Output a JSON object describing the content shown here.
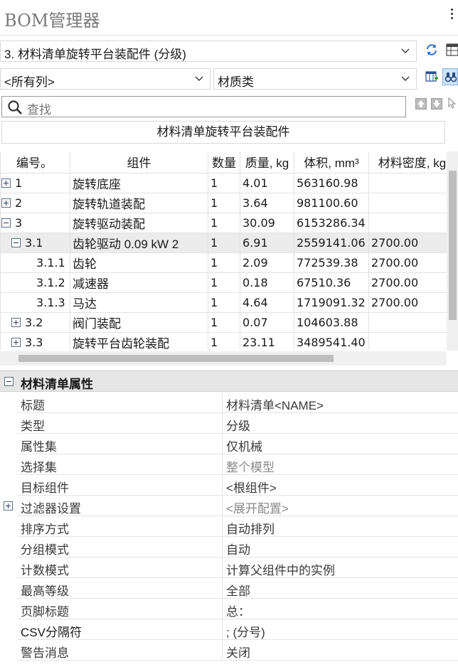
{
  "app": {
    "title": "BOM管理器"
  },
  "toolbar": {
    "bom_select": "3. 材料清单旋转平台装配件 (分级)",
    "columns_select": "<所有列>",
    "category_select": "材质类",
    "search_placeholder": "查找"
  },
  "bom": {
    "title": "材料清单旋转平台装配件",
    "columns": [
      "编号。",
      "组件",
      "数量",
      "质量, kg",
      "体积, mm³",
      "材料密度, kg"
    ],
    "rows": [
      {
        "num": "1",
        "name": "旋转底座",
        "qty": "1",
        "mass": "4.01",
        "volume": "563160.98",
        "density": "",
        "expander": "plus",
        "level": 0
      },
      {
        "num": "2",
        "name": "旋转轨道装配",
        "qty": "1",
        "mass": "3.64",
        "volume": "981100.60",
        "density": "",
        "expander": "plus",
        "level": 0
      },
      {
        "num": "3",
        "name": "旋转驱动装配",
        "qty": "1",
        "mass": "30.09",
        "volume": "6153286.34",
        "density": "",
        "expander": "minus",
        "level": 0
      },
      {
        "num": "3.1",
        "name": "齿轮驱动 0.09 kW 2",
        "qty": "1",
        "mass": "6.91",
        "volume": "2559141.06",
        "density": "2700.00",
        "expander": "minus",
        "level": 1
      },
      {
        "num": "3.1.1",
        "name": "齿轮",
        "qty": "1",
        "mass": "2.09",
        "volume": "772539.38",
        "density": "2700.00",
        "expander": "",
        "level": 2
      },
      {
        "num": "3.1.2",
        "name": "减速器",
        "qty": "1",
        "mass": "0.18",
        "volume": "67510.36",
        "density": "2700.00",
        "expander": "",
        "level": 2
      },
      {
        "num": "3.1.3",
        "name": "马达",
        "qty": "1",
        "mass": "4.64",
        "volume": "1719091.32",
        "density": "2700.00",
        "expander": "",
        "level": 2
      },
      {
        "num": "3.2",
        "name": "阀门装配",
        "qty": "1",
        "mass": "0.07",
        "volume": "104603.88",
        "density": "",
        "expander": "plus",
        "level": 1
      },
      {
        "num": "3.3",
        "name": "旋转平台齿轮装配",
        "qty": "1",
        "mass": "23.11",
        "volume": "3489541.40",
        "density": "",
        "expander": "plus",
        "level": 1
      }
    ]
  },
  "properties": {
    "header": "材料清单属性",
    "items": [
      {
        "key": "标题",
        "value": "材料清单<NAME>",
        "dim": false,
        "expander": false
      },
      {
        "key": "类型",
        "value": "分级",
        "dim": false,
        "expander": false
      },
      {
        "key": "属性集",
        "value": "仅机械",
        "dim": false,
        "expander": false
      },
      {
        "key": "选择集",
        "value": "整个模型",
        "dim": true,
        "expander": false
      },
      {
        "key": "目标组件",
        "value": "<根组件>",
        "dim": false,
        "expander": false
      },
      {
        "key": "过滤器设置",
        "value": "<展开配置>",
        "dim": true,
        "expander": true
      },
      {
        "key": "排序方式",
        "value": "自动排列",
        "dim": false,
        "expander": false
      },
      {
        "key": "分组模式",
        "value": "自动",
        "dim": false,
        "expander": false
      },
      {
        "key": "计数模式",
        "value": "计算父组件中的实例",
        "dim": false,
        "expander": false
      },
      {
        "key": "最高等级",
        "value": "全部",
        "dim": false,
        "expander": false
      },
      {
        "key": "页脚标题",
        "value": "总：",
        "dim": false,
        "expander": false
      },
      {
        "key": "CSV分隔符",
        "value": "; (分号)",
        "dim": false,
        "expander": false
      },
      {
        "key": "警告消息",
        "value": "关闭",
        "dim": false,
        "expander": false
      }
    ]
  },
  "colors": {
    "accent": "#2a6fd6",
    "grid_line": "#e2e2e2",
    "header_bg": "#e6e6e6"
  },
  "icons": [
    "refresh-icon",
    "table-view-icon",
    "column-settings-icon",
    "binoculars-icon",
    "move-up-icon",
    "move-down-icon",
    "cursor-select-icon",
    "search-icon",
    "more-options-icon"
  ]
}
